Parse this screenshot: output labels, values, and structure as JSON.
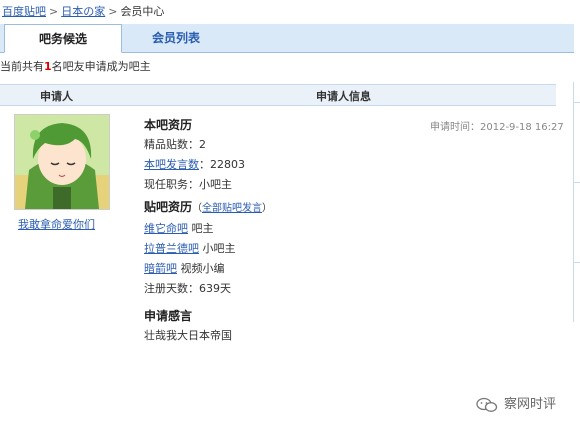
{
  "breadcrumb": {
    "items": [
      "百度贴吧",
      "日本の家",
      "会员中心"
    ],
    "separator": ">"
  },
  "tabs": [
    {
      "label": "吧务候选",
      "active": true
    },
    {
      "label": "会员列表",
      "active": false
    }
  ],
  "notice": {
    "prefix": "当前共有",
    "count": "1",
    "suffix": "名吧友申请成为吧主"
  },
  "table": {
    "col_applicant": "申请人",
    "col_info": "申请人信息"
  },
  "applicant": {
    "username": "我敢拿命爱你们",
    "apply_time": "申请时间：2012-9-18 16:27",
    "bar_record": {
      "title": "本吧资历",
      "featured_posts": "精品贴数：2",
      "post_count_label": "本吧发言数",
      "post_count_value": "：22803",
      "role": "现任职务：小吧主"
    },
    "forum_record": {
      "title": "贴吧资历",
      "all_posts_link": "全部贴吧发言",
      "paren_open": "（",
      "paren_close": "）",
      "forums": [
        {
          "name": "维它命吧",
          "role": "吧主"
        },
        {
          "name": "拉普兰德吧",
          "role": "小吧主"
        },
        {
          "name": "暗箭吧",
          "role": "视频小编"
        }
      ],
      "register_days": "注册天数：639天"
    },
    "statement": {
      "title": "申请感言",
      "text": "壮哉我大日本帝国"
    }
  },
  "watermark": {
    "text": "察网时评"
  },
  "colors": {
    "link": "#2a5db0",
    "tab_bg": "#d9e9f7",
    "count": "#dd0000"
  }
}
